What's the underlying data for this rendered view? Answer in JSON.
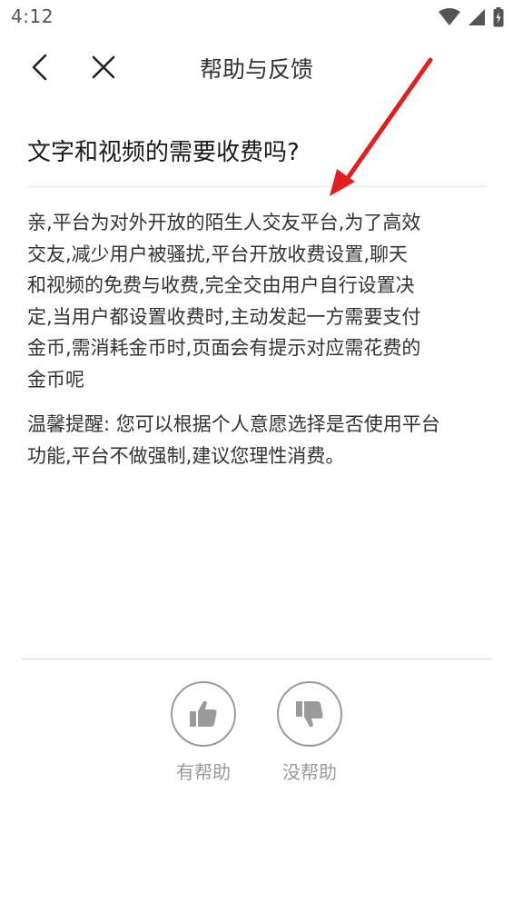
{
  "status_bar": {
    "time": "4:12",
    "icons": [
      "wifi-icon",
      "cellular-signal-icon",
      "battery-icon"
    ]
  },
  "nav": {
    "title": "帮助与反馈",
    "back_icon": "chevron-left-icon",
    "close_icon": "close-icon"
  },
  "question": {
    "title": "文字和视频的需要收费吗?"
  },
  "answer": {
    "lines": [
      "亲,平台为对外开放的陌生人交友平台,为了高效",
      "交友,减少用户被骚扰,平台开放收费设置,聊天",
      "和视频的免费与收费,完全交由用户自行设置决",
      "定,当用户都设置收费时,主动发起一方需要支付",
      "金币,需消耗金币时,页面会有提示对应需花费的",
      "金币呢"
    ],
    "reminder_lines": [
      "温馨提醒: 您可以根据个人意愿选择是否使用平台",
      "功能,平台不做强制,建议您理性消费。"
    ]
  },
  "feedback": {
    "helpful_label": "有帮助",
    "unhelpful_label": "没帮助",
    "helpful_icon": "thumbs-up-icon",
    "unhelpful_icon": "thumbs-down-icon"
  },
  "colors": {
    "annotation_arrow": "#e02020",
    "feedback_gray": "#9a9a9a",
    "text": "#333333"
  }
}
